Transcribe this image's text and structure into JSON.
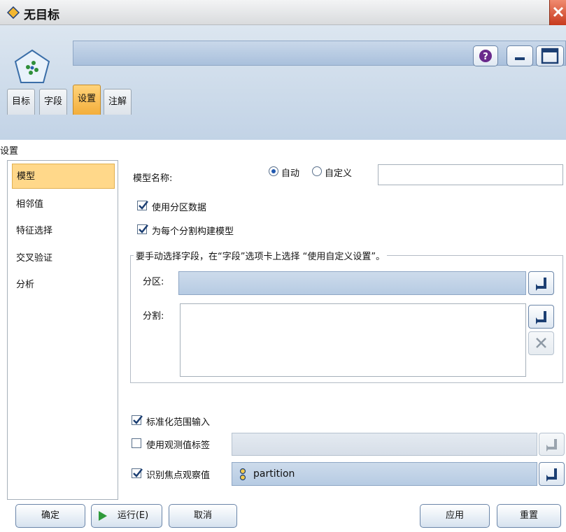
{
  "window": {
    "title": "无目标",
    "colors": {
      "accent": "#f3ae3b",
      "title_bg": "#dfe1e3",
      "header_bg": "#c2d3e6",
      "close": "#d6492b"
    }
  },
  "tabs": [
    {
      "label": "目标"
    },
    {
      "label": "字段"
    },
    {
      "label": "设置"
    },
    {
      "label": "注解"
    }
  ],
  "active_tab": "设置",
  "section_title": "设置",
  "left_nav": [
    {
      "label": "模型"
    },
    {
      "label": "相邻值"
    },
    {
      "label": "特征选择"
    },
    {
      "label": "交叉验证"
    },
    {
      "label": "分析"
    }
  ],
  "model_name": {
    "label": "模型名称:",
    "auto_label": "自动",
    "custom_label": "自定义",
    "value": "",
    "selected": "自动"
  },
  "use_partition": {
    "label": "使用分区数据",
    "checked": true
  },
  "build_per_split": {
    "label": "为每个分割构建模型",
    "checked": true
  },
  "manual_group": {
    "legend": "要手动选择字段，在“字段”选项卡上选择 “使用自定义设置”。",
    "partition_label": "分区:",
    "partition_value": "",
    "split_label": "分割:"
  },
  "normalize": {
    "label": "标准化范围输入",
    "checked": true
  },
  "case_labels": {
    "label": "使用观测值标签",
    "checked": false,
    "value": ""
  },
  "focal_cases": {
    "label": "识别焦点观察值",
    "checked": true,
    "value": "partition"
  },
  "buttons": {
    "ok": "确定",
    "run": "运行(E)",
    "cancel": "取消",
    "apply": "应用",
    "reset": "重置"
  }
}
